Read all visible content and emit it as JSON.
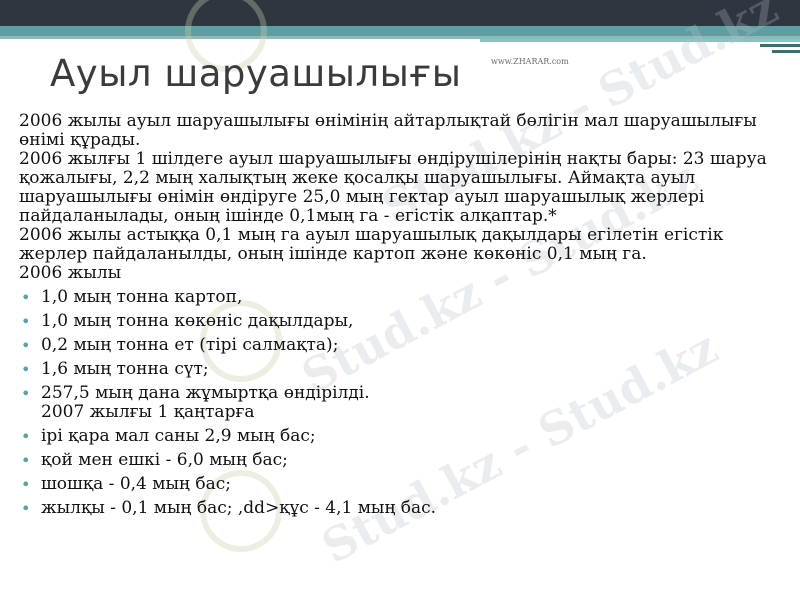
{
  "site_url": "www.ZHARAR.com",
  "watermark_text": "Stud.kz - Stud.kz",
  "title": "Ауыл шаруашылығы",
  "paragraphs": [
    "2006 жылы ауыл шаруашылығы өнімінің айтарлықтай бөлігін мал шаруашылығы өнімі құрады.",
    "2006 жылғы 1 шілдеге ауыл шаруашылығы өндірушілерінің нақты бары: 23 шаруа қожалығы, 2,2 мың халықтың жеке қосалқы шаруашылығы. Аймақта ауыл шаруашылығы өнімін өндіруге 25,0 мың гектар ауыл шаруашылық жерлері пайдаланылады, оның ішінде 0,1мың га - егістік алқаптар.*",
    "2006 жылы астыққа 0,1 мың га ауыл шаруашылық дақылдары егілетін егістік жерлер пайдаланылды, оның ішінде картоп және көкөніс 0,1 мың га.",
    "2006 жылы"
  ],
  "bullets": [
    {
      "text": "1,0 мың тонна картоп,"
    },
    {
      "text": "1,0 мың тонна көкөніс дақылдары,"
    },
    {
      "text": "0,2 мың тонна ет (тірі салмақта);"
    },
    {
      "text": "1,6 мың тонна сүт;"
    },
    {
      "text": "257,5 мың дана жұмыртқа өндірілді.",
      "sub": "2007 жылғы 1 қаңтарға"
    },
    {
      "text": "ірі қара мал саны 2,9 мың бас;"
    },
    {
      "text": "қой мен ешкі - 6,0 мың бас;"
    },
    {
      "text": "шошқа - 0,4 мың бас;"
    },
    {
      "text": "жылқы - 0,1 мың бас; ,dd>құс - 4,1 мың бас."
    }
  ],
  "colors": {
    "top_bar": "#2f3640",
    "accent_teal": "#5f9ea0",
    "bullet": "#5aa0a8",
    "title": "#3b3b3b"
  }
}
